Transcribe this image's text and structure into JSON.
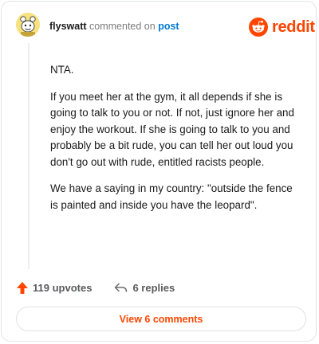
{
  "header": {
    "username": "flyswatt",
    "action_text": "commented on",
    "link_text": "post",
    "logo_text": "reddit",
    "avatar_icon": "snoo-avatar-icon",
    "logo_icon": "reddit-alien-icon"
  },
  "comment": {
    "paragraphs": [
      "NTA.",
      "If you meet her at the gym, it all depends if she is going to talk to you or not. If not, just ignore her and enjoy the workout. If she is going to talk to you and probably be a bit rude, you can tell her out loud you don't go out with rude, entitled racists people.",
      "We have a saying in my country: \"outside the fence is painted and inside you have the leopard\"."
    ]
  },
  "actions": {
    "upvotes_label": "119 upvotes",
    "replies_label": "6 replies",
    "upvote_icon": "upvote-arrow-icon",
    "reply_icon": "reply-arrow-icon"
  },
  "footer": {
    "view_comments_label": "View 6 comments"
  },
  "colors": {
    "accent": "#ff4500",
    "link": "#0079d3",
    "text": "#1a1a1b",
    "muted": "#7c7c7c"
  }
}
